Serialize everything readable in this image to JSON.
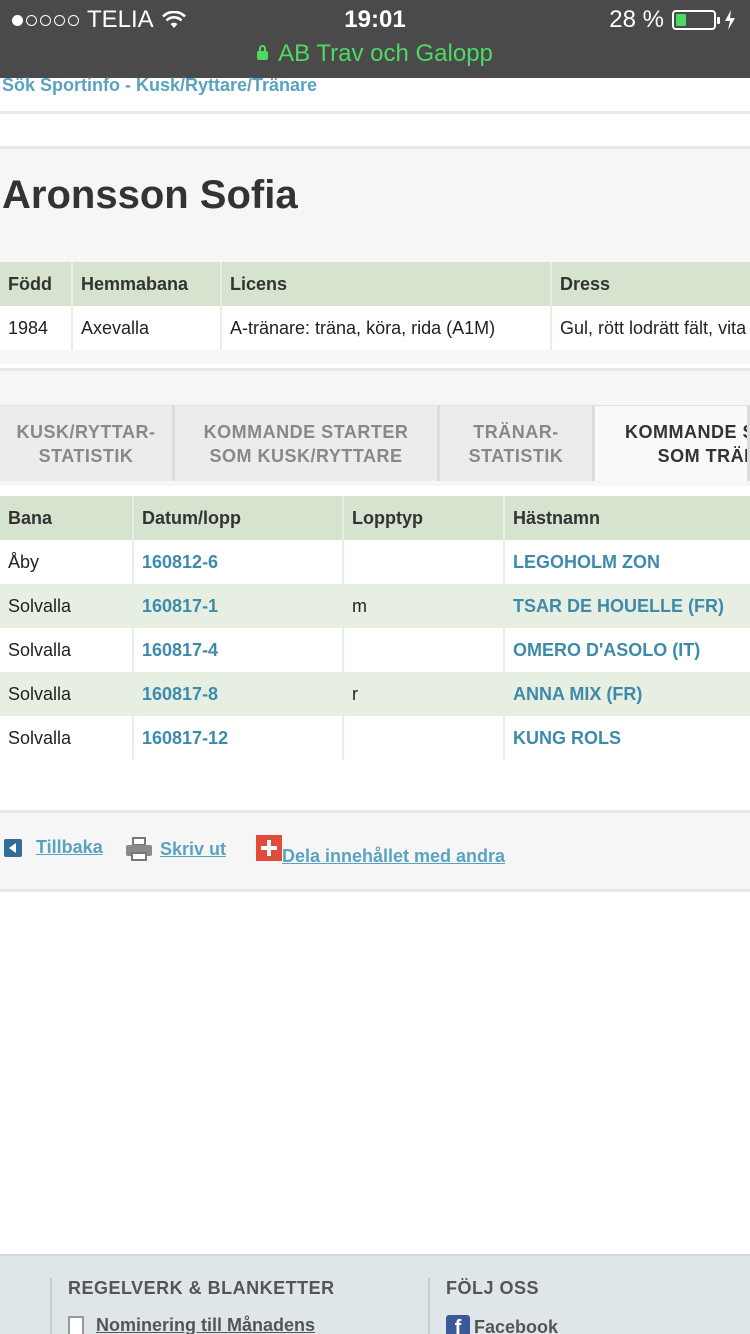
{
  "status_bar": {
    "carrier": "TELIA",
    "time": "19:01",
    "battery": "28 %",
    "battery_level": 0.28,
    "url": "AB Trav och Galopp"
  },
  "breadcrumb": "Sök Sportinfo - Kusk/Ryttare/Tränare",
  "page_title": "Aronsson Sofia",
  "info_table": {
    "headers": [
      "Född",
      "Hemmabana",
      "Licens",
      "Dress"
    ],
    "row": [
      "1984",
      "Axevalla",
      "A-tränare: träna, köra, rida (A1M)",
      "Gul, rött lodrätt fält, vita"
    ]
  },
  "tabs": [
    {
      "line1": "KUSK/RYTTAR-",
      "line2": "STATISTIK"
    },
    {
      "line1": "KOMMANDE STARTER",
      "line2": "SOM KUSK/RYTTARE"
    },
    {
      "line1": "TRÄNAR-",
      "line2": "STATISTIK"
    },
    {
      "line1": "KOMMANDE STARTER",
      "line2": "SOM TRÄNARE"
    }
  ],
  "races_table": {
    "headers": [
      "Bana",
      "Datum/lopp",
      "Lopptyp",
      "Hästnamn"
    ],
    "rows": [
      {
        "bana": "Åby",
        "datum": "160812-6",
        "typ": "",
        "hast": "LEGOHOLM ZON"
      },
      {
        "bana": "Solvalla",
        "datum": "160817-1",
        "typ": "m",
        "hast": "TSAR DE HOUELLE (FR)"
      },
      {
        "bana": "Solvalla",
        "datum": "160817-4",
        "typ": "",
        "hast": "OMERO D'ASOLO (IT)"
      },
      {
        "bana": "Solvalla",
        "datum": "160817-8",
        "typ": "r",
        "hast": "ANNA MIX (FR)"
      },
      {
        "bana": "Solvalla",
        "datum": "160817-12",
        "typ": "",
        "hast": "KUNG ROLS"
      }
    ]
  },
  "actions": {
    "back": "Tillbaka",
    "print": "Skriv ut",
    "share": "Dela innehållet med andra"
  },
  "footer": {
    "col1_title": "REGELVERK & BLANKETTER",
    "col1_item": "Nominering till Månadens",
    "col2_title": "FÖLJ OSS",
    "col2_item": "Facebook"
  }
}
